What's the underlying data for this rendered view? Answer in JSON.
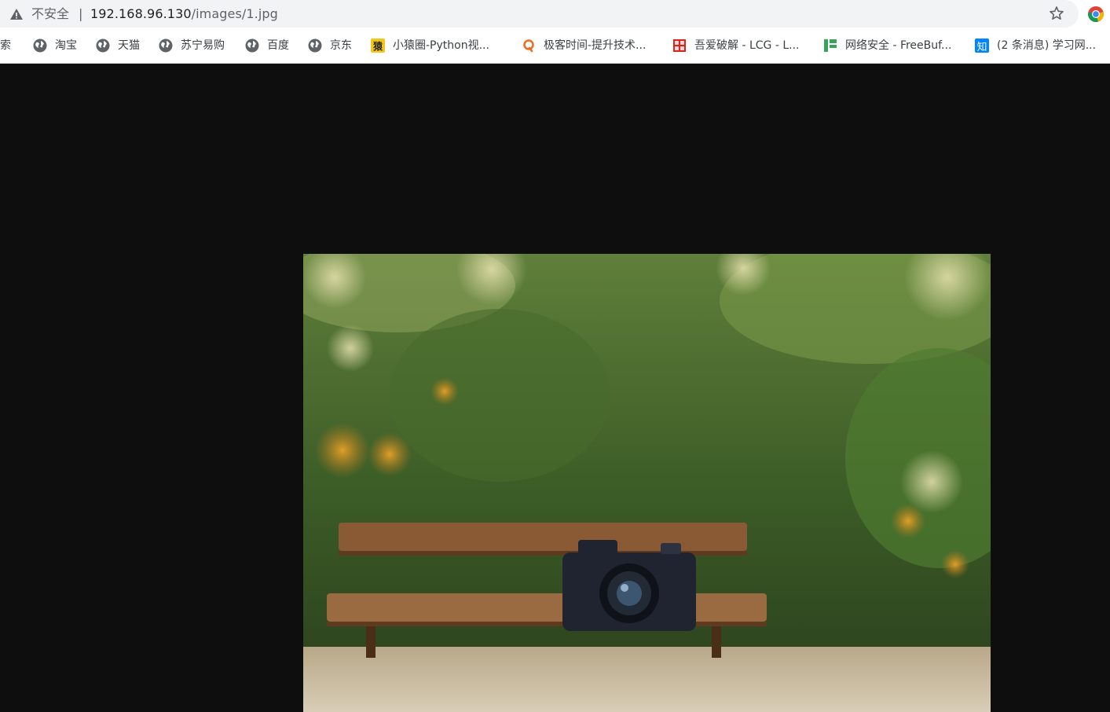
{
  "browser": {
    "security_label": "不安全",
    "divider": "|",
    "url_host": "192.168.96.130",
    "url_path": "/images/1.jpg",
    "bookmarks": [
      {
        "label": "搜索",
        "icon": "globe-icon"
      },
      {
        "label": "淘宝",
        "icon": "globe-icon"
      },
      {
        "label": "天猫",
        "icon": "globe-icon"
      },
      {
        "label": "苏宁易购",
        "icon": "globe-icon"
      },
      {
        "label": "百度",
        "icon": "globe-icon"
      },
      {
        "label": "京东",
        "icon": "globe-icon"
      },
      {
        "label": "小猿圈-Python视...",
        "icon": "xiaoyuan-icon",
        "icon_text": "猿"
      },
      {
        "label": "极客时间-提升技术...",
        "icon": "geektime-icon"
      },
      {
        "label": "吾爱破解 - LCG - L...",
        "icon": "52pojie-icon"
      },
      {
        "label": "网络安全 - FreeBuf...",
        "icon": "freebuf-icon"
      },
      {
        "label": "(2 条消息) 学习网...",
        "icon": "zhihu-icon",
        "icon_text": "知"
      }
    ]
  },
  "viewer": {
    "background": "#0e0e0e",
    "image_alt": "1.jpg"
  },
  "colors": {
    "chrome_bg": "#f1f3f4",
    "text": "#202124",
    "muted": "#5f6368",
    "zhihu_blue": "#0084ff",
    "xiaoyuan_yellow": "#f5c518",
    "geektime_orange": "#f06b1d",
    "pojie_red": "#d9251d",
    "freebuf_green": "#37a35b"
  }
}
